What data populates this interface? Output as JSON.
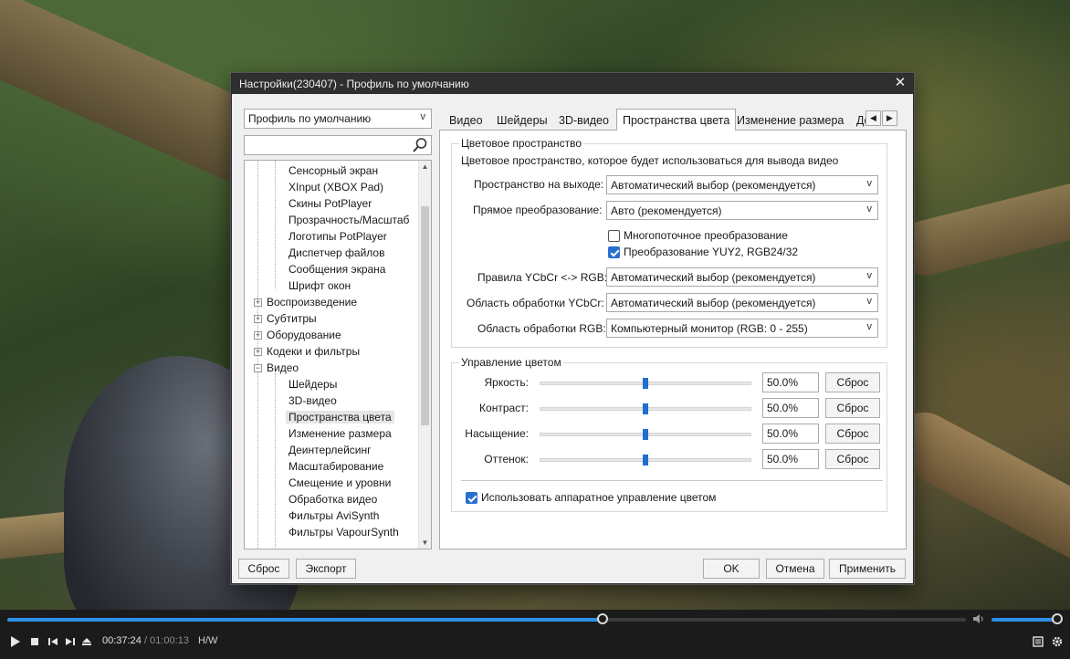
{
  "dialog": {
    "title": "Настройки(230407) - Профиль по умолчанию",
    "close_glyph": "✕",
    "profile_select": "Профиль по умолчанию",
    "search_placeholder": "",
    "footer": {
      "reset": "Сброс",
      "export": "Экспорт",
      "ok": "OK",
      "cancel": "Отмена",
      "apply": "Применить"
    }
  },
  "tree": {
    "items": [
      {
        "label": "Сенсорный экран",
        "type": "child"
      },
      {
        "label": "XInput (XBOX Pad)",
        "type": "child"
      },
      {
        "label": "Скины PotPlayer",
        "type": "child"
      },
      {
        "label": "Прозрачность/Масштаб",
        "type": "child"
      },
      {
        "label": "Логотипы PotPlayer",
        "type": "child"
      },
      {
        "label": "Диспетчер файлов",
        "type": "child"
      },
      {
        "label": "Сообщения экрана",
        "type": "child"
      },
      {
        "label": "Шрифт окон",
        "type": "child"
      },
      {
        "label": "Воспроизведение",
        "type": "group",
        "expander": "+"
      },
      {
        "label": "Субтитры",
        "type": "group",
        "expander": "+"
      },
      {
        "label": "Оборудование",
        "type": "group",
        "expander": "+"
      },
      {
        "label": "Кодеки и фильтры",
        "type": "group",
        "expander": "+"
      },
      {
        "label": "Видео",
        "type": "group",
        "expander": "−"
      },
      {
        "label": "Шейдеры",
        "type": "child"
      },
      {
        "label": "3D-видео",
        "type": "child"
      },
      {
        "label": "Пространства цвета",
        "type": "child",
        "selected": true
      },
      {
        "label": "Изменение размера",
        "type": "child"
      },
      {
        "label": "Деинтерлейсинг",
        "type": "child"
      },
      {
        "label": "Масштабирование",
        "type": "child"
      },
      {
        "label": "Смещение и уровни",
        "type": "child"
      },
      {
        "label": "Обработка видео",
        "type": "child"
      },
      {
        "label": "Фильтры AviSynth",
        "type": "child"
      },
      {
        "label": "Фильтры VapourSynth",
        "type": "child"
      }
    ]
  },
  "tabs": [
    "Видео",
    "Шейдеры",
    "3D-видео",
    "Пространства цвета",
    "Изменение размера",
    "Де"
  ],
  "active_tab": "Пространства цвета",
  "colorspace": {
    "group_title": "Цветовое пространство",
    "description": "Цветовое пространство, которое будет использоваться для вывода видео",
    "output_space": {
      "label": "Пространство на выходе:",
      "value": "Автоматический выбор (рекомендуется)"
    },
    "direct_conv": {
      "label": "Прямое преобразование:",
      "value": "Авто (рекомендуется)"
    },
    "multithread": {
      "label": "Многопоточное преобразование",
      "checked": false
    },
    "yuy2": {
      "label": "Преобразование YUY2, RGB24/32",
      "checked": true
    },
    "ycbcr_rules": {
      "label": "Правила YCbCr <-> RGB:",
      "value": "Автоматический выбор (рекомендуется)"
    },
    "ycbcr_range": {
      "label": "Область обработки YCbCr:",
      "value": "Автоматический выбор (рекомендуется)"
    },
    "rgb_range": {
      "label": "Область обработки RGB:",
      "value": "Компьютерный монитор (RGB: 0 - 255)"
    }
  },
  "color_control": {
    "group_title": "Управление цветом",
    "sliders": [
      {
        "label": "Яркость:",
        "value": "50.0%",
        "level": 0.5,
        "reset": "Сброс"
      },
      {
        "label": "Контраст:",
        "value": "50.0%",
        "level": 0.5,
        "reset": "Сброс"
      },
      {
        "label": "Насыщение:",
        "value": "50.0%",
        "level": 0.5,
        "reset": "Сброс"
      },
      {
        "label": "Оттенок:",
        "value": "50.0%",
        "level": 0.5,
        "reset": "Сброс"
      }
    ],
    "hw_control": {
      "label": "Использовать аппаратное управление цветом",
      "checked": true
    }
  },
  "player": {
    "current_time": "00:37:24",
    "total_time": "/ 01:00:13",
    "decoder": "H/W",
    "progress": 0.621,
    "volume": 1.0
  }
}
